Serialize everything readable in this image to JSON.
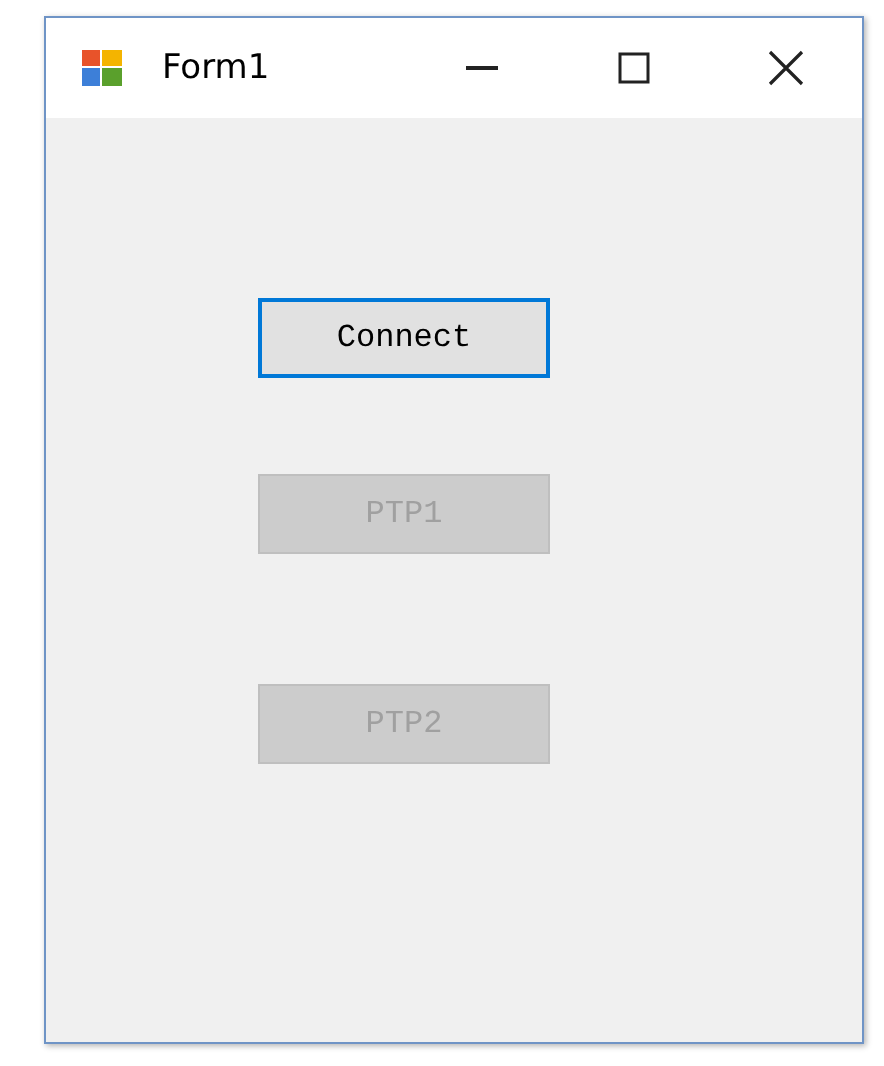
{
  "window": {
    "title": "Form1"
  },
  "buttons": [
    {
      "label": "Connect",
      "disabled": false,
      "focused": true
    },
    {
      "label": "PTP1",
      "disabled": true,
      "focused": false
    },
    {
      "label": "PTP2",
      "disabled": true,
      "focused": false
    }
  ]
}
